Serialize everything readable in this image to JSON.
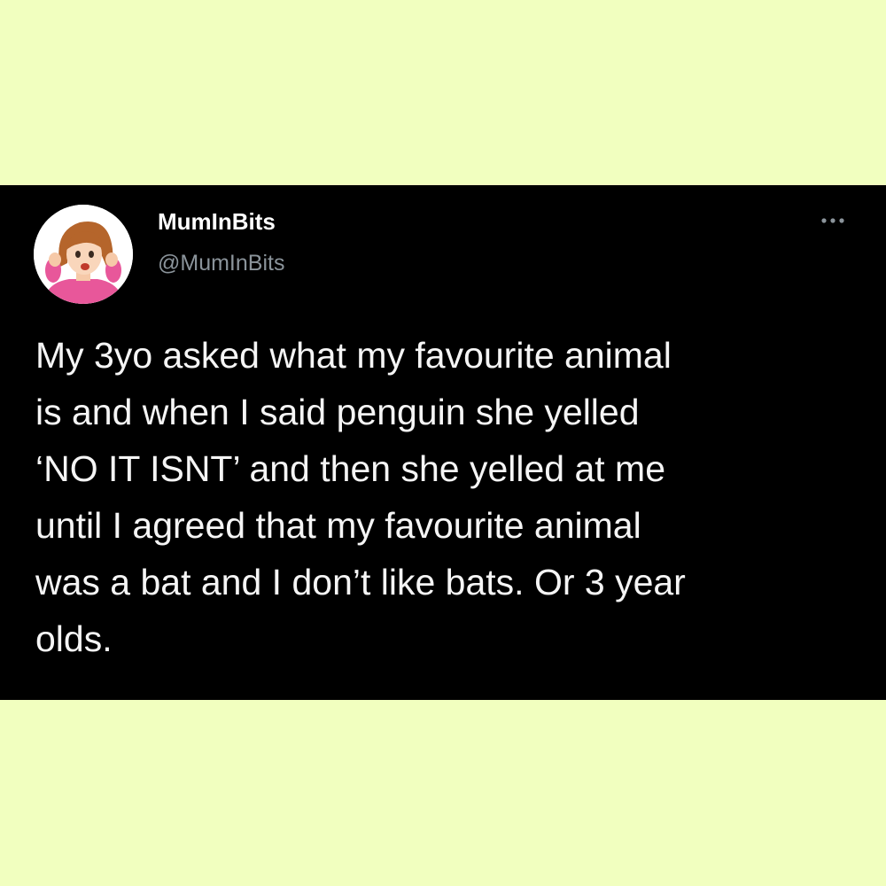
{
  "tweet": {
    "display_name": "MumInBits",
    "handle": "@MumInBits",
    "text": "My 3yo asked what my favourite animal\nis and when I said penguin she yelled\n‘NO IT ISNT’ and then she yelled at me\nuntil I agreed that my favourite animal\nwas a bat and I don’t like bats. Or 3 year\nolds.",
    "more_icon": "more-dots-icon",
    "avatar_icon": "cartoon-woman-avatar"
  },
  "colors": {
    "page_background": "#f1ffbf",
    "card_background": "#000000",
    "text": "#f5f5f5",
    "handle": "#8b949b"
  }
}
